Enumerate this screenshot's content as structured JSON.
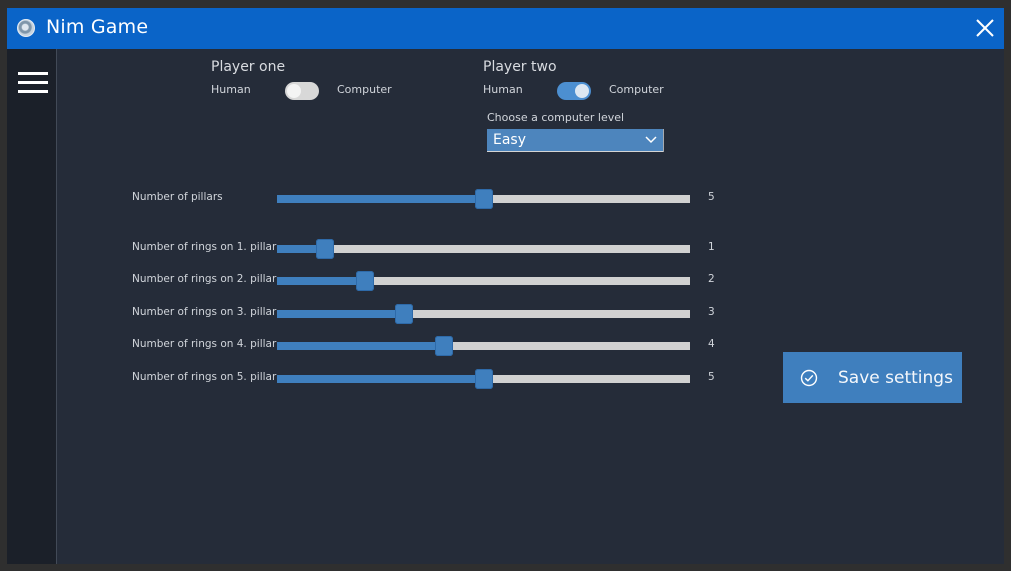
{
  "window": {
    "title": "Nim Game",
    "icons": {
      "app": "app-icon",
      "close": "close-icon",
      "menu": "menu-icon"
    }
  },
  "colors": {
    "titlebar": "#0a64c8",
    "accent": "#3f7fbe",
    "background": "#252c39",
    "sidebar": "#1b2029"
  },
  "players": {
    "one": {
      "label": "Player one",
      "left_option": "Human",
      "right_option": "Computer",
      "computer_selected": false
    },
    "two": {
      "label": "Player two",
      "left_option": "Human",
      "right_option": "Computer",
      "computer_selected": true
    }
  },
  "computer_level": {
    "label": "Choose a computer level",
    "selected": "Easy",
    "icon": "chevron-down-icon"
  },
  "pillars": {
    "label": "Number of pillars",
    "value": "5",
    "fraction": 0.5
  },
  "rings": [
    {
      "label": "Number of rings on 1. pillar",
      "value": "1",
      "fraction": 0.116
    },
    {
      "label": "Number of rings on 2. pillar",
      "value": "2",
      "fraction": 0.213
    },
    {
      "label": "Number of rings on 3. pillar",
      "value": "3",
      "fraction": 0.308
    },
    {
      "label": "Number of rings on 4. pillar",
      "value": "4",
      "fraction": 0.405
    },
    {
      "label": "Number of rings on 5. pillar",
      "value": "5",
      "fraction": 0.5
    }
  ],
  "save": {
    "label": "Save settings",
    "icon": "check-circle-icon"
  }
}
